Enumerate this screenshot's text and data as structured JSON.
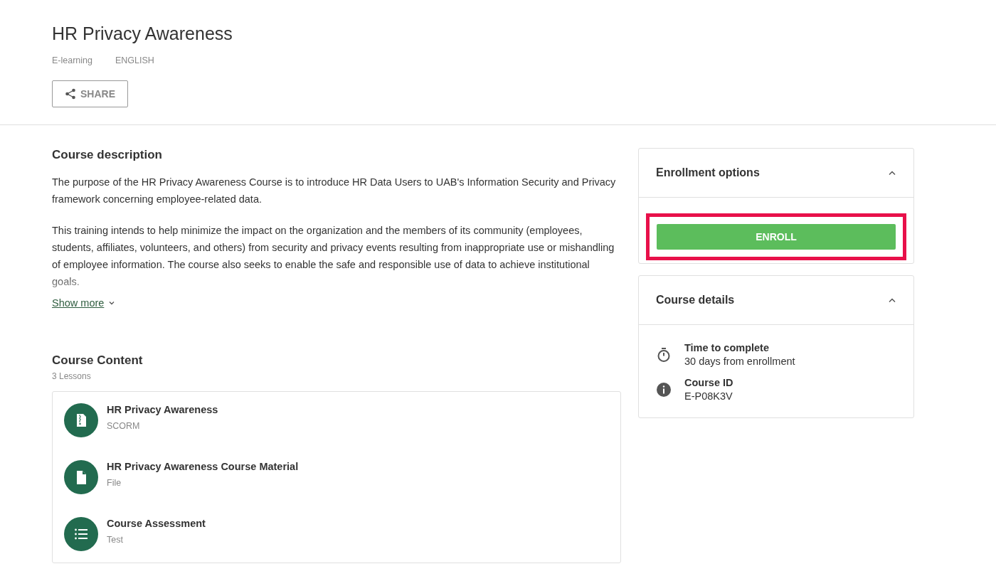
{
  "header": {
    "title": "HR Privacy Awareness",
    "meta": [
      "E-learning",
      "ENGLISH"
    ],
    "share_button": "SHARE"
  },
  "description": {
    "heading": "Course description",
    "paragraphs": [
      "The purpose of the HR Privacy Awareness Course is to introduce HR Data Users to UAB's Information Security and Privacy framework concerning employee-related data.",
      "This training intends to help minimize the impact on the organization and the members of its community (employees, students, affiliates, volunteers, and others) from security and privacy events resulting from inappropriate use or mishandling of employee information. The course also seeks to enable the safe and responsible use of data to achieve institutional goals."
    ],
    "show_more": "Show more",
    "expanded": false
  },
  "content": {
    "heading": "Course Content",
    "count": "3 Lessons",
    "lessons": [
      {
        "kind": "scorm",
        "title": "HR Privacy Awareness",
        "type": "SCORM"
      },
      {
        "kind": "file",
        "title": "HR Privacy Awareness Course Material",
        "type": "File"
      },
      {
        "kind": "test",
        "title": "Course Assessment",
        "type": "Test"
      }
    ]
  },
  "enrollment": {
    "title": "Enrollment options",
    "expanded": true,
    "button": "ENROLL",
    "highlighted": true
  },
  "details": {
    "title": "Course details",
    "expanded": true,
    "items": [
      {
        "kind": "time",
        "label": "Time to complete",
        "value": "30 days from enrollment"
      },
      {
        "kind": "info",
        "label": "Course ID",
        "value": "E-P08K3V"
      }
    ]
  }
}
